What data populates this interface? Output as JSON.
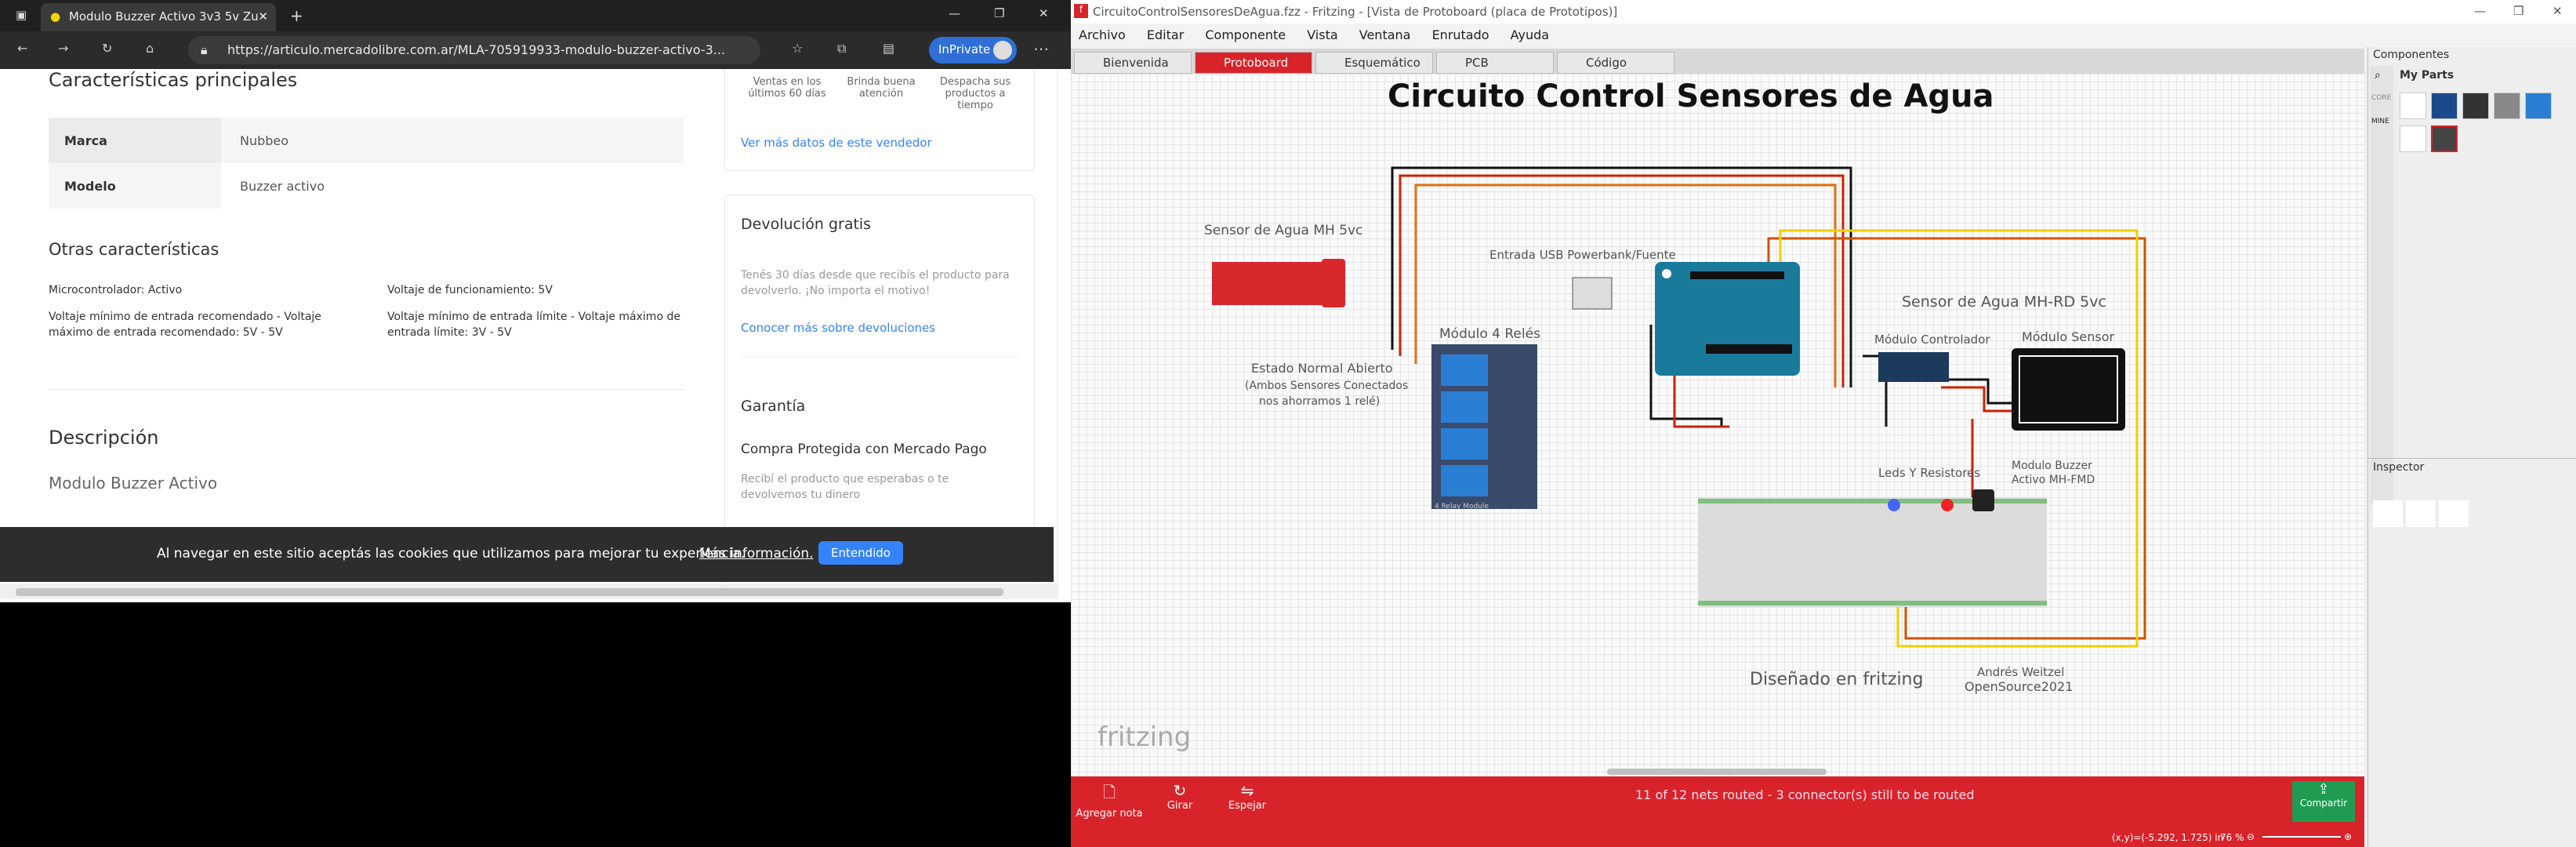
{
  "browser": {
    "tab_title": "Modulo Buzzer Activo 3v3 5v Zu",
    "url": "https://articulo.mercadolibre.com.ar/MLA-705919933-modulo-buzzer-activo-3...",
    "inprivate_label": "InPrivate"
  },
  "listing": {
    "main_features_title": "Características principales",
    "main_features": [
      {
        "key": "Marca",
        "value": "Nubbeo"
      },
      {
        "key": "Modelo",
        "value": "Buzzer activo"
      }
    ],
    "other_features_title": "Otras características",
    "other_features": [
      "Microcontrolador: Activo",
      "Voltaje de funcionamiento: 5V",
      "Voltaje mínimo de entrada recomendado - Voltaje máximo de entrada recomendado: 5V - 5V",
      "Voltaje mínimo de entrada límite - Voltaje máximo de entrada límite: 3V - 5V"
    ],
    "description_title": "Descripción",
    "description_text": "Modulo Buzzer Activo",
    "seller": {
      "stat_sales": "Ventas en los últimos 60 días",
      "stat_attention": "Brinda buena atención",
      "stat_dispatch": "Despacha sus productos a tiempo",
      "more_link": "Ver más datos de este vendedor"
    },
    "returns": {
      "title": "Devolución gratis",
      "text": "Tenés 30 días desde que recibís el producto para devolverlo. ¡No importa el motivo!",
      "link": "Conocer más sobre devoluciones"
    },
    "warranty": {
      "title": "Garantía",
      "subtitle": "Compra Protegida con Mercado Pago",
      "text": "Recibí el producto que esperabas o te devolvemos tu dinero"
    }
  },
  "cookie": {
    "text": "Al navegar en este sitio aceptás las cookies que utilizamos para mejorar tu experiencia.",
    "more": "Más información.",
    "button": "Entendido"
  },
  "fritzing": {
    "window_title": "CircuitoControlSensoresDeAgua.fzz - Fritzing - [Vista de Protoboard (placa de Prototipos)]",
    "menu": [
      "Archivo",
      "Editar",
      "Componente",
      "Vista",
      "Ventana",
      "Enrutado",
      "Ayuda"
    ],
    "tabs": [
      "Bienvenida",
      "Protoboard",
      "Esquemático",
      "PCB",
      "Código"
    ],
    "active_tab": "Protoboard",
    "circuit_title": "Circuito Control Sensores de Agua",
    "labels": {
      "sensor_mh": "Sensor de Agua MH 5vc",
      "usb": "Entrada USB Powerbank/Fuente",
      "relay": "Módulo 4 Relés",
      "normal_state": "Estado Normal Abierto",
      "normal_note_1": "(Ambos Sensores Conectados",
      "normal_note_2": "nos ahorramos 1 relé)",
      "sensor_mhrd": "Sensor de Agua MH-RD 5vc",
      "controller": "Módulo Controlador",
      "sensor_module": "Módulo Sensor",
      "leds": "Leds Y Resistores",
      "buzzer_1": "Modulo Buzzer",
      "buzzer_2": "Activo MH-FMD",
      "designed": "Diseñado en fritzing",
      "author_1": "Andrés Weitzel",
      "author_2": "OpenSource2021",
      "relay_board": "4 Relay Module"
    },
    "watermark": "fritzing",
    "routing_status": "11 of 12 nets routed - 3 connector(s) still to be routed",
    "toolbar": {
      "add_note": "Agregar nota",
      "rotate": "Girar",
      "flip": "Espejar",
      "share": "Compartir"
    },
    "coords": "(x,y)=(-5.292, 1.725) in",
    "zoom": "76 %",
    "components_title": "Componentes",
    "my_parts": "My Parts",
    "inspector_title": "Inspector",
    "bins": [
      "CORE",
      "MINE"
    ]
  },
  "colors": {
    "fritzing_red": "#d8232a",
    "ml_blue": "#3483fa",
    "share_green": "#1f9c52"
  }
}
